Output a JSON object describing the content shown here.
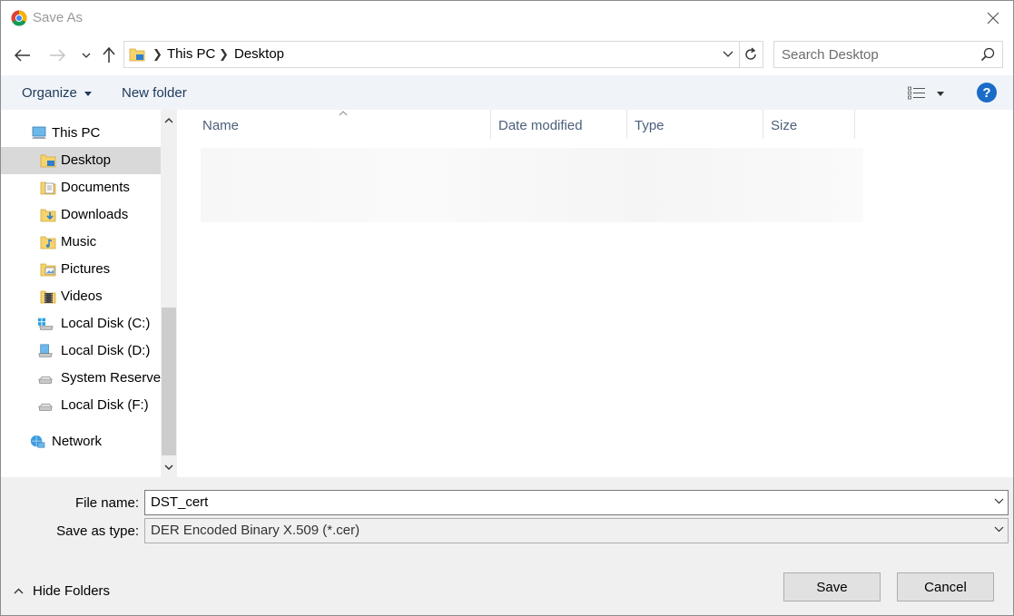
{
  "window": {
    "title": "Save As"
  },
  "address": {
    "crumbs": [
      "This PC",
      "Desktop"
    ]
  },
  "search": {
    "placeholder": "Search Desktop"
  },
  "toolbar": {
    "organize_label": "Organize",
    "new_folder_label": "New folder",
    "help_label": "?"
  },
  "sidebar": {
    "items": [
      {
        "label": "This PC",
        "icon": "computer-icon"
      },
      {
        "label": "Desktop",
        "icon": "desktop-folder-icon",
        "selected": true
      },
      {
        "label": "Documents",
        "icon": "documents-folder-icon"
      },
      {
        "label": "Downloads",
        "icon": "downloads-folder-icon"
      },
      {
        "label": "Music",
        "icon": "music-folder-icon"
      },
      {
        "label": "Pictures",
        "icon": "pictures-folder-icon"
      },
      {
        "label": "Videos",
        "icon": "videos-folder-icon"
      },
      {
        "label": "Local Disk (C:)",
        "icon": "windows-drive-icon"
      },
      {
        "label": "Local Disk (D:)",
        "icon": "drive-icon"
      },
      {
        "label": "System Reserved",
        "icon": "drive-icon"
      },
      {
        "label": "Local Disk (F:)",
        "icon": "drive-icon"
      },
      {
        "label": "Network",
        "icon": "network-icon"
      }
    ]
  },
  "columns": {
    "name": "Name",
    "date_modified": "Date modified",
    "type": "Type",
    "size": "Size"
  },
  "form": {
    "file_name_label": "File name:",
    "file_name_value": "DST_cert",
    "save_type_label": "Save as type:",
    "save_type_value": "DER Encoded Binary X.509 (*.cer)"
  },
  "footer": {
    "hide_folders_label": "Hide Folders",
    "save_label": "Save",
    "cancel_label": "Cancel"
  },
  "colors": {
    "accent": "#1a6cc6",
    "selection": "#d9d9d9",
    "command_bar": "#f0f4f9",
    "bottom_panel": "#f0f0f0"
  }
}
